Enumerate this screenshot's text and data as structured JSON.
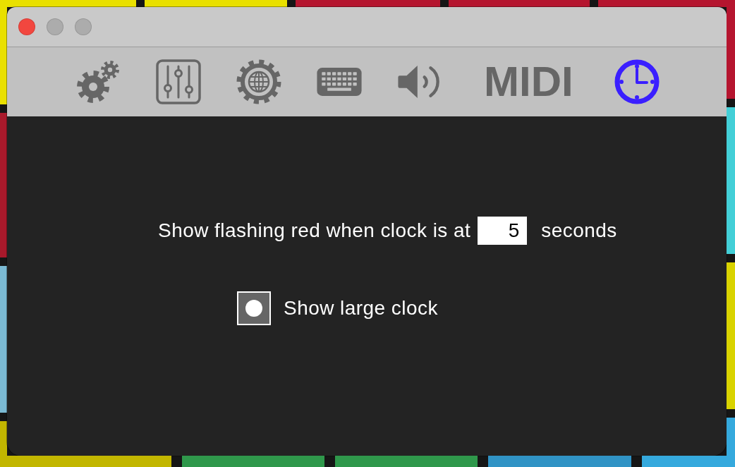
{
  "background_pads": {
    "top": [
      {
        "color": "#e9e000"
      },
      {
        "color": "#e9e000"
      },
      {
        "color": "#b5152f"
      },
      {
        "color": "#b5152f"
      },
      {
        "color": "#b5152f"
      }
    ],
    "left": [
      {
        "color": "#a9192b"
      },
      {
        "color": "#7bbad3"
      }
    ],
    "right": [
      {
        "color": "#43cfd7"
      },
      {
        "color": "#d9d300"
      }
    ],
    "bottom": [
      {
        "color": "#c2b600"
      },
      {
        "color": "#2f984b"
      },
      {
        "color": "#2f984b"
      },
      {
        "color": "#3093c5"
      },
      {
        "color": "#35a9dd"
      }
    ]
  },
  "window": {
    "controls": [
      {
        "kind": "close",
        "disabled": false
      },
      {
        "kind": "minimize",
        "disabled": true
      },
      {
        "kind": "zoom",
        "disabled": true
      }
    ]
  },
  "toolbar": [
    {
      "kind": "gears",
      "selected": false
    },
    {
      "kind": "sliders",
      "selected": false
    },
    {
      "kind": "globe",
      "selected": false
    },
    {
      "kind": "keyboard",
      "selected": false
    },
    {
      "kind": "speaker",
      "selected": false
    },
    {
      "kind": "midi",
      "label": "MIDI",
      "selected": false
    },
    {
      "kind": "clock",
      "selected": true
    }
  ],
  "settings": [
    {
      "kind": "number",
      "label": "Show flashing red when clock is at",
      "value": "5",
      "unit": "seconds"
    },
    {
      "kind": "checkbox",
      "label": "Show large clock",
      "checked": true
    }
  ]
}
